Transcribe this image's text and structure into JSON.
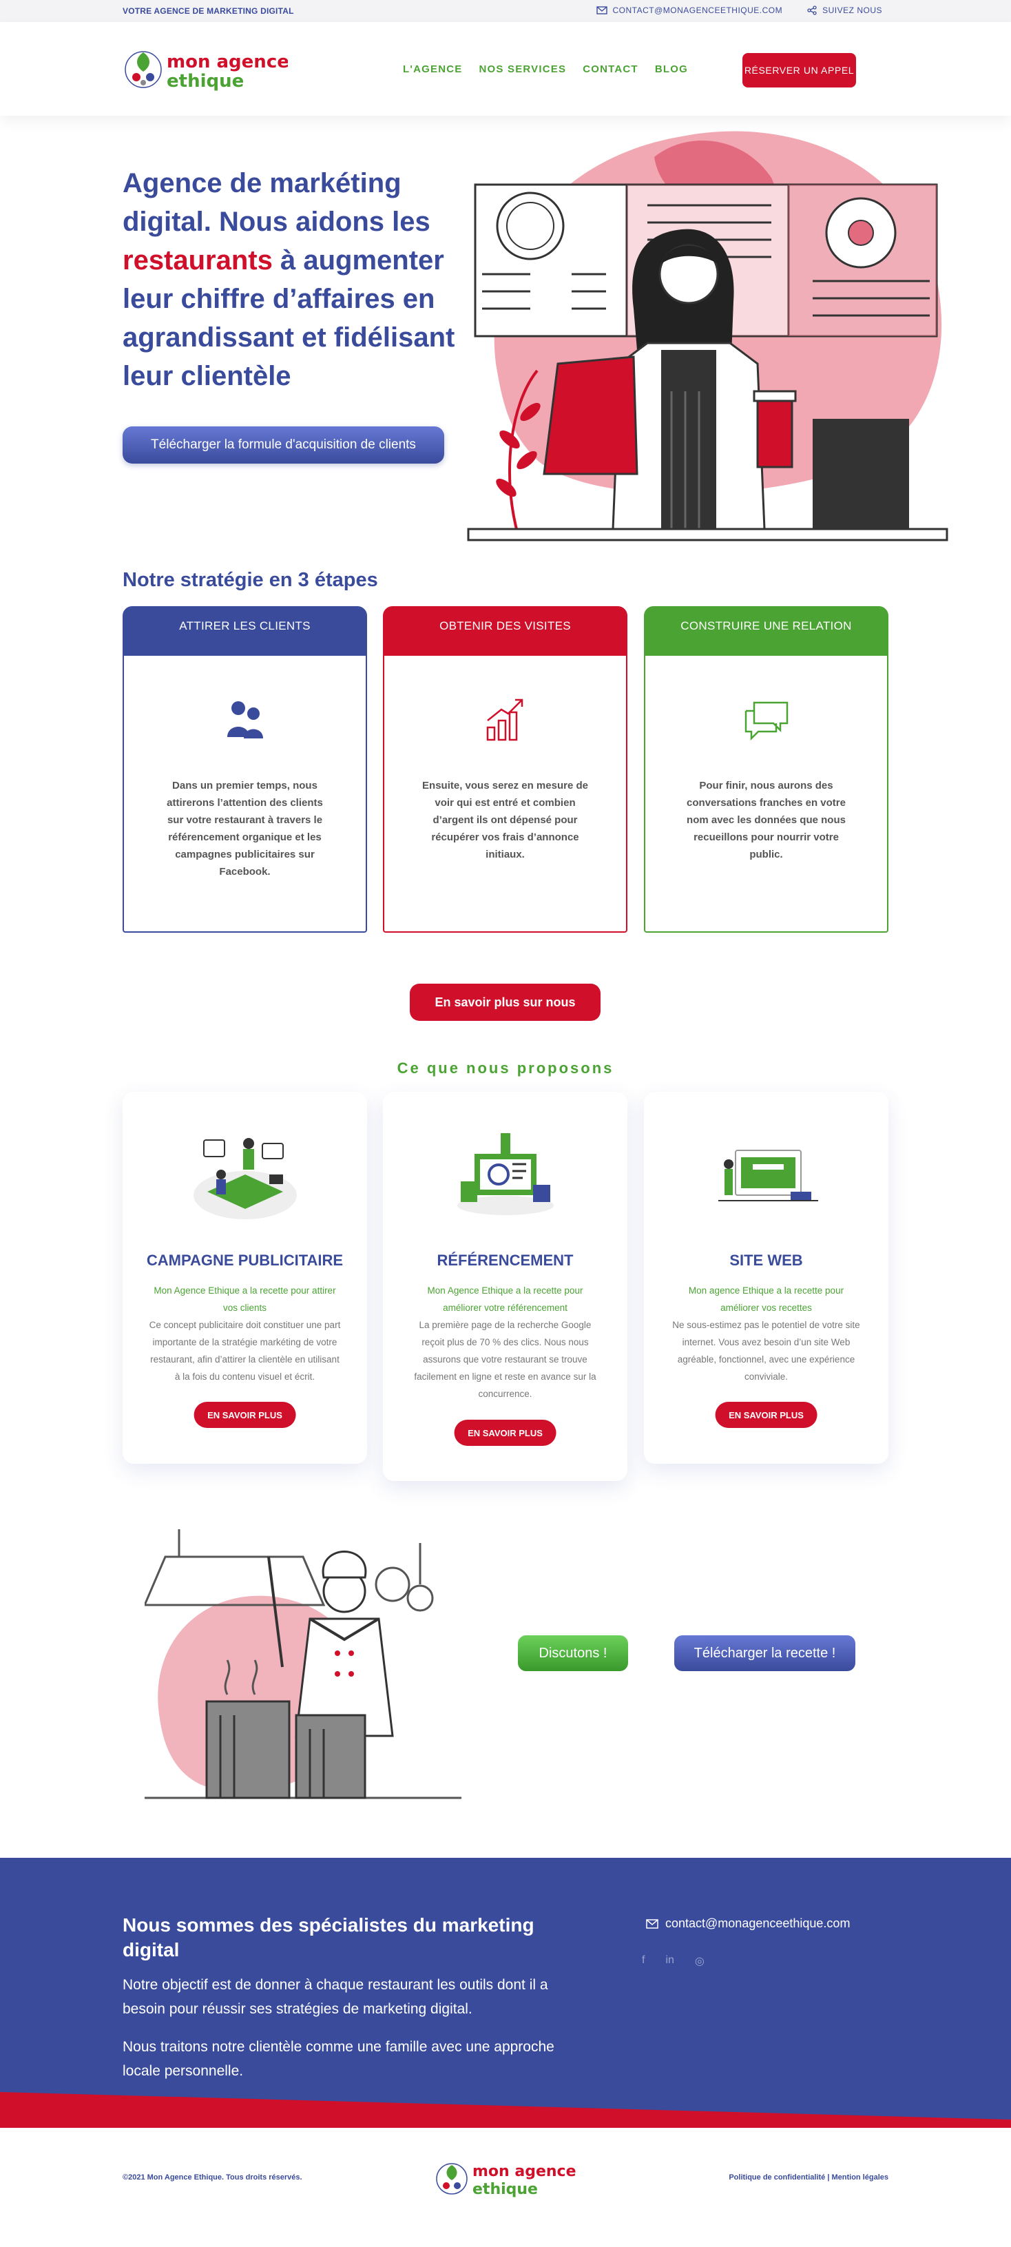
{
  "topbar": {
    "tagline": "VOTRE AGENCE DE MARKETING DIGITAL",
    "email": "CONTACT@MONAGENCEETHIQUE.COM",
    "follow": "SUIVEZ NOUS"
  },
  "header": {
    "logo_text_1": "mon agence",
    "logo_text_2": "ethique",
    "nav": [
      "L'AGENCE",
      "NOS SERVICES",
      "CONTACT",
      "BLOG"
    ],
    "cta": "RÉSERVER UN APPEL"
  },
  "hero": {
    "title_part1": "Agence de markéting digital. Nous aidons les ",
    "title_highlight": "restaurants",
    "title_part2": " à augmenter leur chiffre d’affaires en agrandissant et fidélisant leur clientèle",
    "button": "Télécharger la formule d'acquisition de clients"
  },
  "strategy": {
    "title": "Notre stratégie en 3 étapes",
    "steps": [
      {
        "header": "ATTIRER LES CLIENTS",
        "icon": "people-icon",
        "color": "#3a4b9c",
        "text": "Dans un premier temps, nous attirerons l’attention des clients sur votre restaurant à travers le référencement organique et les campagnes publicitaires sur Facebook."
      },
      {
        "header": "OBTENIR DES VISITES",
        "icon": "growth-chart-icon",
        "color": "#d0102a",
        "text": "Ensuite, vous serez en mesure de voir qui est entré et combien d’argent ils ont dépensé pour récupérer vos frais d’annonce initiaux."
      },
      {
        "header": "CONSTRUIRE UNE RELATION",
        "icon": "chat-bubbles-icon",
        "color": "#4aa333",
        "text": "Pour finir, nous aurons des conversations franches en votre nom avec les données que nous recueillons pour nourrir votre public."
      }
    ],
    "more_button": "En savoir plus sur nous"
  },
  "services": {
    "title": "Ce que nous proposons",
    "items": [
      {
        "title": "CAMPAGNE PUBLICITAIRE",
        "subtitle": "Mon Agence Ethique a la recette pour attirer vos clients",
        "description": "Ce concept publicitaire doit constituer une part importante de la stratégie markéting de votre restaurant, afin d’attirer la clientèle en utilisant à la fois du contenu visuel et écrit.",
        "button": "EN SAVOIR PLUS"
      },
      {
        "title": "RÉFÉRENCEMENT",
        "subtitle": "Mon Agence Ethique a la recette pour améliorer votre référencement",
        "description": "La première page de la recherche Google reçoit plus de 70 % des clics. Nous nous assurons que votre restaurant se trouve facilement en ligne et reste en avance sur la concurrence.",
        "button": "EN SAVOIR PLUS"
      },
      {
        "title": "SITE WEB",
        "subtitle": "Mon agence Ethique a la recette pour améliorer vos recettes",
        "description": "Ne sous-estimez pas le potentiel de votre site internet. Vous avez besoin d’un site Web agréable, fonctionnel, avec une expérience conviviale.",
        "button": "EN SAVOIR PLUS"
      }
    ]
  },
  "cta": {
    "discuss": "Discutons !",
    "download": "Télécharger la recette !"
  },
  "band": {
    "title": "Nous sommes des spécialistes du marketing digital",
    "p1": "Notre objectif est de donner à chaque restaurant les outils dont il a besoin pour réussir ses stratégies de marketing digital.",
    "p2": "Nous traitons notre clientèle comme une famille avec une approche locale personnelle.",
    "email": "contact@monagenceethique.com",
    "socials": [
      "f",
      "in",
      "◎"
    ]
  },
  "footer": {
    "copyright": "©2021 Mon Agence Ethique. Tous droits réservés.",
    "legal": "Politique de confidentialité | Mention légales"
  }
}
